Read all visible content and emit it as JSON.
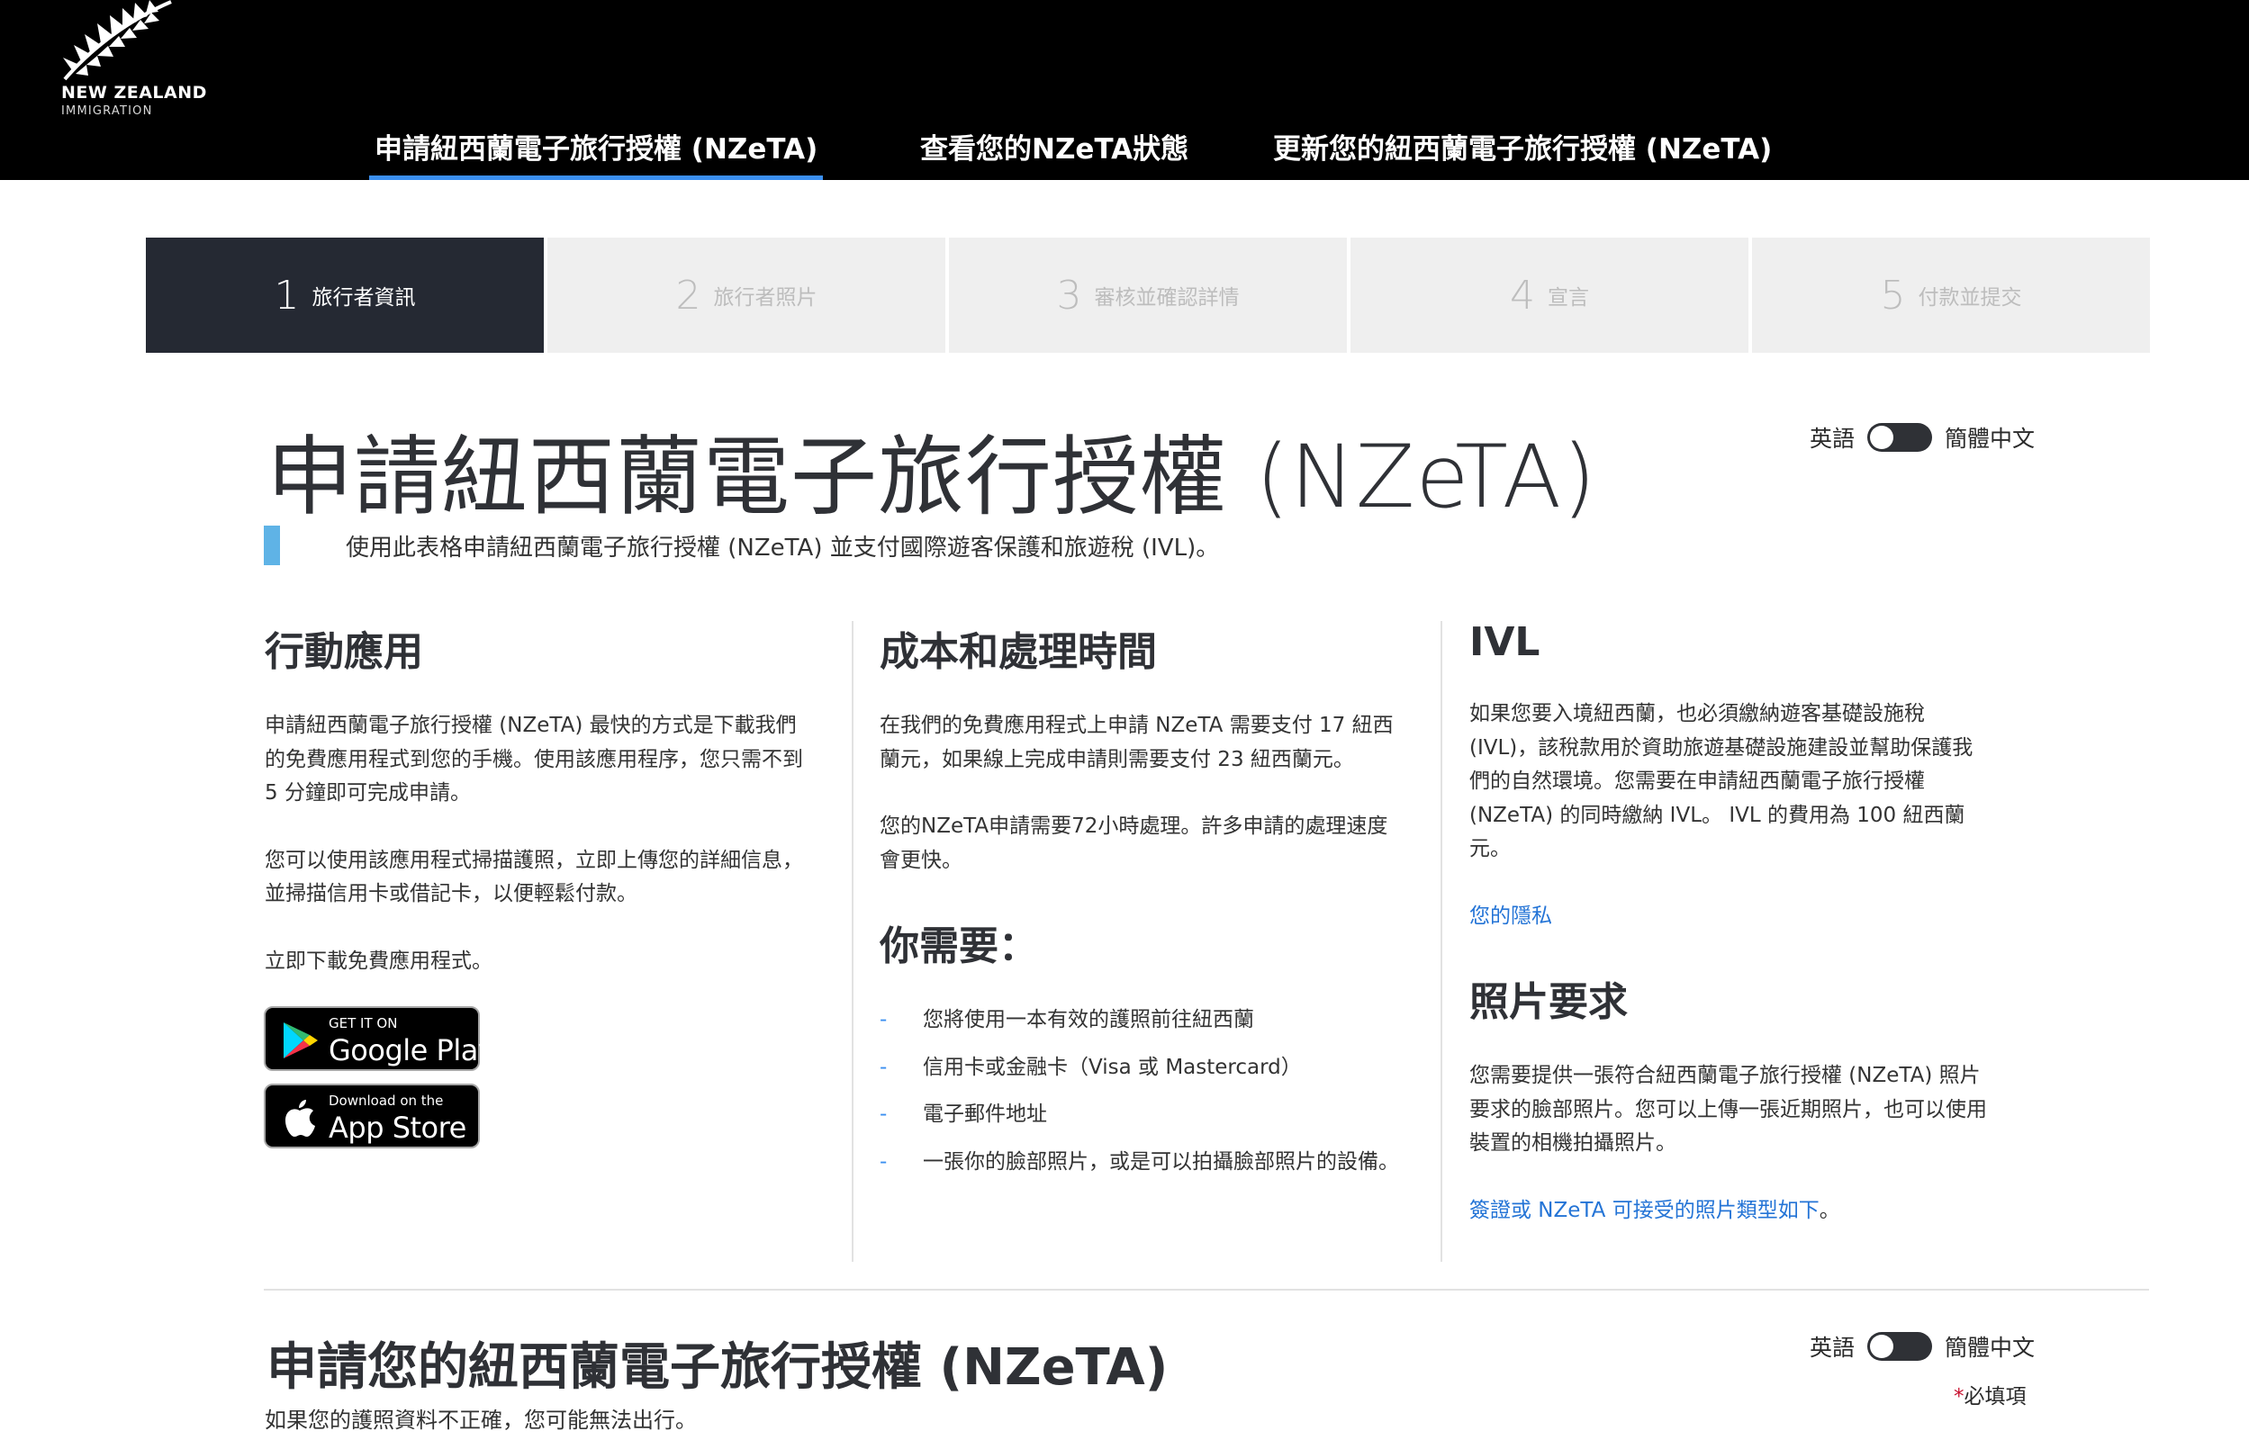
{
  "header": {
    "logo_line1": "NEW ZEALAND",
    "logo_line2": "IMMIGRATION",
    "nav": [
      {
        "label": "申請紐西蘭電子旅行授權 (NZeTA)",
        "active": true
      },
      {
        "label": "查看您的NZeTA狀態",
        "active": false
      },
      {
        "label": "更新您的紐西蘭電子旅行授權 (NZeTA)",
        "active": false
      }
    ],
    "accent_color": "#3b8ff0"
  },
  "stepper": {
    "steps": [
      {
        "num": "1",
        "label": "旅行者資訊",
        "active": true
      },
      {
        "num": "2",
        "label": "旅行者照片",
        "active": false
      },
      {
        "num": "3",
        "label": "審核並確認詳情",
        "active": false
      },
      {
        "num": "4",
        "label": "宣言",
        "active": false
      },
      {
        "num": "5",
        "label": "付款並提交",
        "active": false
      }
    ]
  },
  "page": {
    "title": "申請紐西蘭電子旅行授權 (NZeTA)",
    "lead": "使用此表格申請紐西蘭電子旅行授權 (NZeTA) 並支付國際遊客保護和旅遊稅 (IVL)。"
  },
  "language_toggle": {
    "left": "英語",
    "right": "簡體中文"
  },
  "mobile": {
    "heading": "行動應用",
    "para1": "申請紐西蘭電子旅行授權 (NZeTA) 最快的方式是下載我們的免費應用程式到您的手機。使用該應用程序，您只需不到 5 分鐘即可完成申請。",
    "para2": "您可以使用該應用程式掃描護照，立即上傳您的詳細信息，並掃描信用卡或借記卡，以便輕鬆付款。",
    "para3": "立即下載免費應用程式。",
    "google_small": "GET IT ON",
    "google_big": "Google Play",
    "apple_small": "Download on the",
    "apple_big": "App Store"
  },
  "cost": {
    "heading": "成本和處理時間",
    "para1": "在我們的免費應用程式上申請 NZeTA 需要支付 17 紐西蘭元，如果線上完成申請則需要支付 23 紐西蘭元。",
    "para2": "您的NZeTA申請需要72小時處理。許多申請的處理速度會更快。",
    "need_heading": "你需要：",
    "need_items": [
      "您將使用一本有效的護照前往紐西蘭",
      "信用卡或金融卡（Visa 或 Mastercard）",
      "電子郵件地址",
      "一張你的臉部照片，或是可以拍攝臉部照片的設備。"
    ]
  },
  "ivl": {
    "heading": "IVL",
    "para1": "如果您要入境紐西蘭，也必須繳納遊客基礎設施稅 (IVL)，該稅款用於資助旅遊基礎設施建設並幫助保護我們的自然環境。您需要在申請紐西蘭電子旅行授權 (NZeTA) 的同時繳納 IVL。 IVL 的費用為 100 紐西蘭元。",
    "privacy_link": "您的隱私",
    "photo_heading": "照片要求",
    "photo_para": "您需要提供一張符合紐西蘭電子旅行授權 (NZeTA) 照片要求的臉部照片。您可以上傳一張近期照片，也可以使用裝置的相機拍攝照片。",
    "photo_link": "簽證或 NZeTA 可接受的照片類型如下",
    "photo_link_suffix": "。"
  },
  "form": {
    "title": "申請您的紐西蘭電子旅行授權 (NZeTA)",
    "note": "如果您的護照資料不正確，您可能無法出行。",
    "required_star": "*",
    "required_label": "必填項"
  }
}
